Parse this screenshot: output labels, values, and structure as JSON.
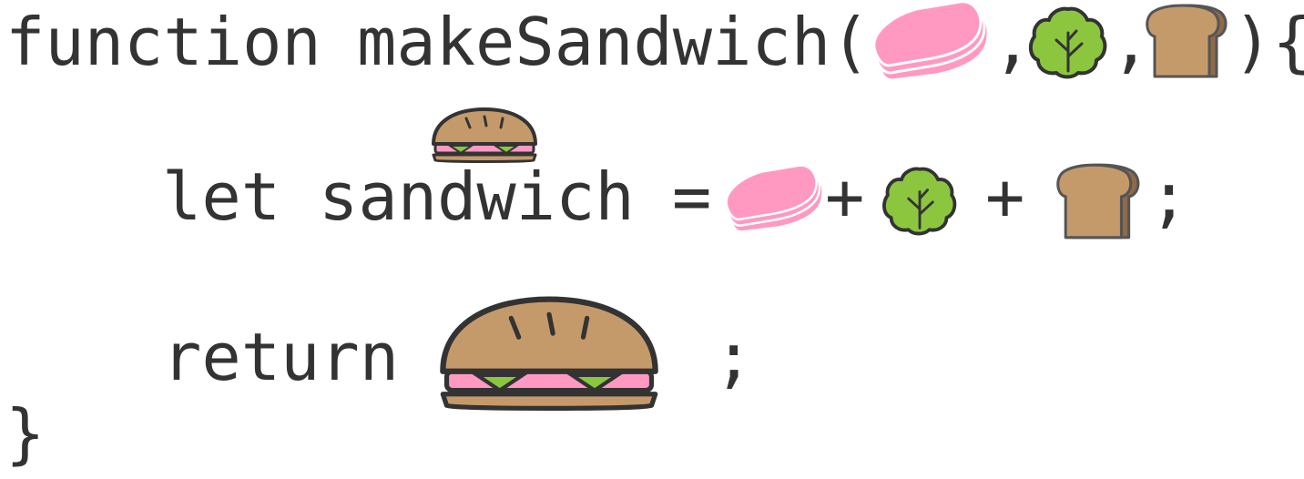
{
  "code": {
    "line1_function_keyword": "function",
    "line1_function_name": "makeSandwich(",
    "line1_comma_1": ",",
    "line1_comma_2": ",",
    "line1_close": "){",
    "line2_let_keyword": "let",
    "line2_variable": "sandwich",
    "line2_equals": "=",
    "line2_plus_1": "+",
    "line2_plus_2": "+",
    "line2_semicolon": ";",
    "line3_return_keyword": "return",
    "line3_semicolon": ";",
    "line4_close_brace": "}"
  },
  "icons": {
    "ham": "ham-slices-icon",
    "lettuce": "lettuce-icon",
    "bread": "bread-slice-icon",
    "sandwich": "sandwich-icon"
  },
  "colors": {
    "text": "#333333",
    "ham": "#ff99c2",
    "lettuce": "#8cc63f",
    "bread": "#c59a6a",
    "outline": "#333333"
  }
}
